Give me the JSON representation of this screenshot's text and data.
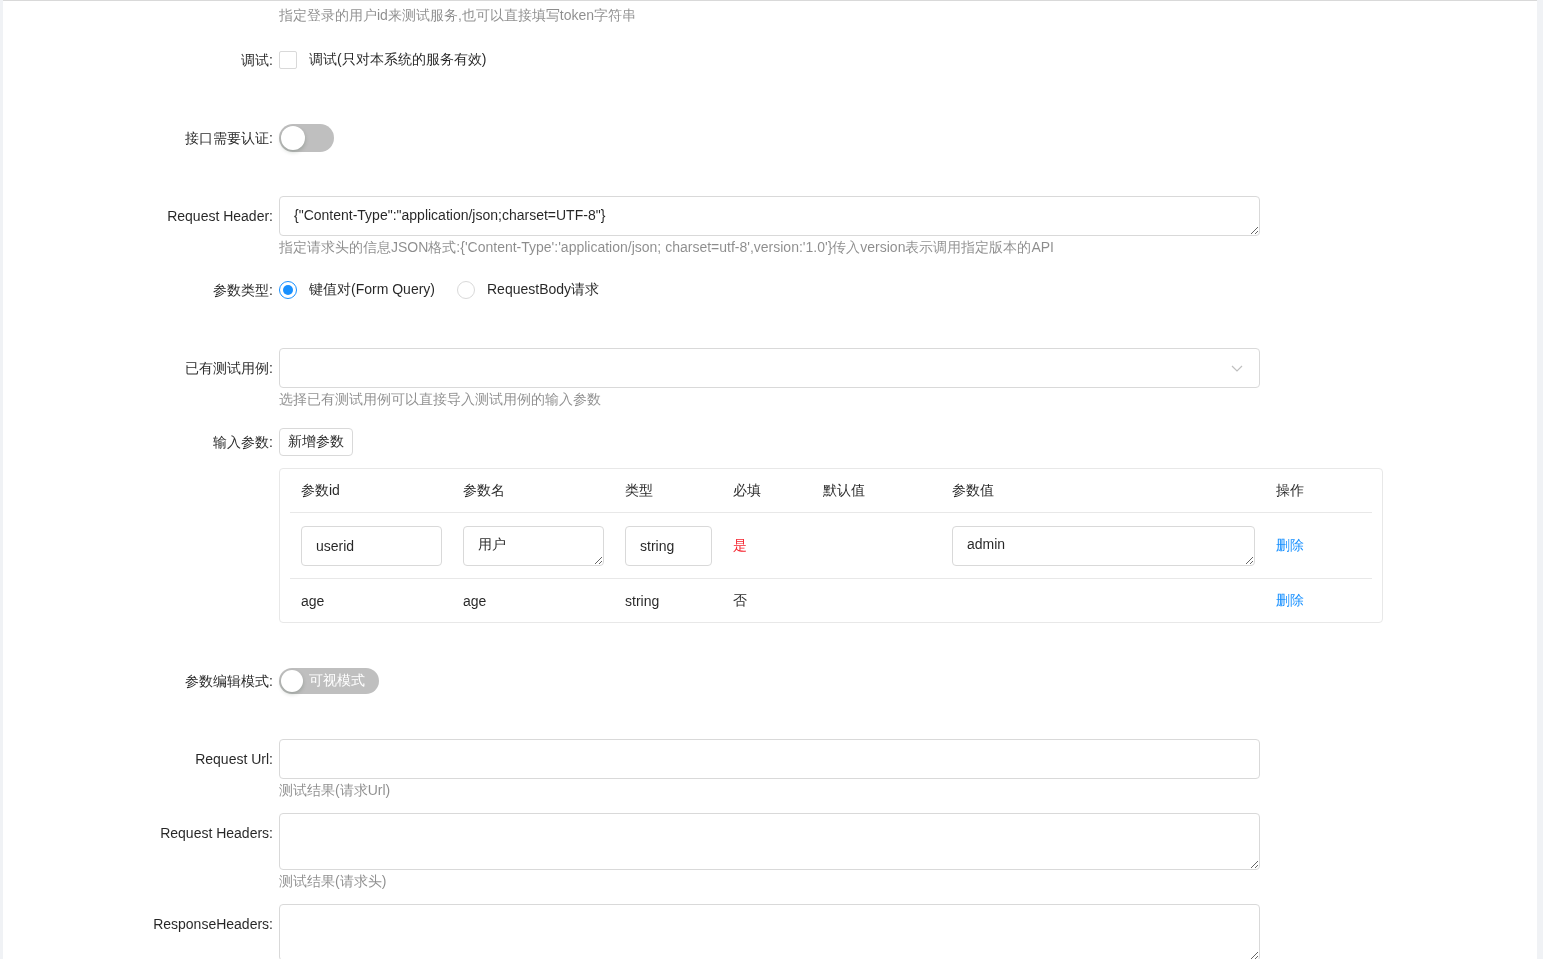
{
  "form": {
    "items": [
      {
        "kind": "hint_only",
        "hint": "指定登录的用户id来测试服务,也可以直接填写token字符串"
      },
      {
        "kind": "checkbox",
        "label": "调试:",
        "option": "调试(只对本系统的服务有效)",
        "checked": false
      },
      {
        "kind": "switch",
        "label": "接口需要认证:",
        "on": false
      },
      {
        "kind": "textarea",
        "label": "Request Header:",
        "value": "{\"Content-Type\":\"application/json;charset=UTF-8\"}",
        "hint": "指定请求头的信息JSON格式:{'Content-Type':'application/json; charset=utf-8',version:'1.0'}传入version表示调用指定版本的API"
      },
      {
        "kind": "radio",
        "label": "参数类型:",
        "options": [
          {
            "label": "键值对(Form Query)",
            "selected": true
          },
          {
            "label": "RequestBody请求",
            "selected": false
          }
        ]
      },
      {
        "kind": "select",
        "label": "已有测试用例:",
        "hint": "选择已有测试用例可以直接导入测试用例的输入参数"
      },
      {
        "kind": "params",
        "label": "输入参数:",
        "button": "新增参数"
      },
      {
        "kind": "switch",
        "label": "参数编辑模式:",
        "on": false,
        "text": "可视模式"
      },
      {
        "kind": "input",
        "label": "Request Url:",
        "hint": "测试结果(请求Url)"
      },
      {
        "kind": "textarea",
        "label": "Request Headers:",
        "hint": "测试结果(请求头)"
      },
      {
        "kind": "textarea",
        "label": "ResponseHeaders:"
      }
    ]
  },
  "params_table": {
    "columns": [
      "参数id",
      "参数名",
      "类型",
      "必填",
      "默认值",
      "参数值",
      "操作"
    ],
    "rows": [
      {
        "id": {
          "kind": "input",
          "value": "userid"
        },
        "name": {
          "kind": "textarea",
          "value": "用户"
        },
        "type": {
          "kind": "input",
          "value": "string"
        },
        "required": {
          "kind": "flag",
          "text": "是",
          "on": true
        },
        "value": {
          "kind": "textarea",
          "value": "admin"
        },
        "action": {
          "kind": "link",
          "text": "删除"
        }
      },
      {
        "id": {
          "kind": "text",
          "value": "age"
        },
        "name": {
          "kind": "text",
          "value": "age"
        },
        "type": {
          "kind": "text",
          "value": "string"
        },
        "required": {
          "kind": "flag",
          "text": "否",
          "on": false
        },
        "action": {
          "kind": "link",
          "text": "删除"
        }
      }
    ]
  }
}
